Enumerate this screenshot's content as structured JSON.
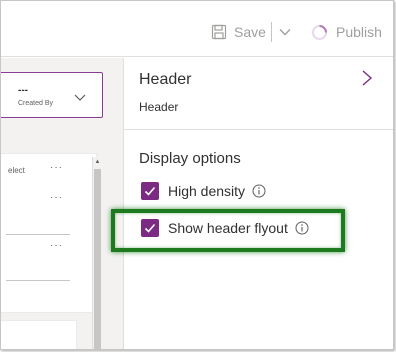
{
  "toolbar": {
    "save_label": "Save",
    "publish_label": "Publish"
  },
  "canvas": {
    "header_card": {
      "value": "---",
      "label": "Created By"
    },
    "body_card": {
      "select_text": "elect",
      "more_symbol": "···"
    }
  },
  "panel": {
    "title": "Header",
    "subtitle": "Header",
    "section_title": "Display options",
    "options": [
      {
        "label": "High density",
        "checked": true
      },
      {
        "label": "Show header flyout",
        "checked": true
      }
    ]
  },
  "colors": {
    "accent": "#7b2b82",
    "highlight": "#1e7a1e",
    "disabled_text": "#a19f9d"
  }
}
